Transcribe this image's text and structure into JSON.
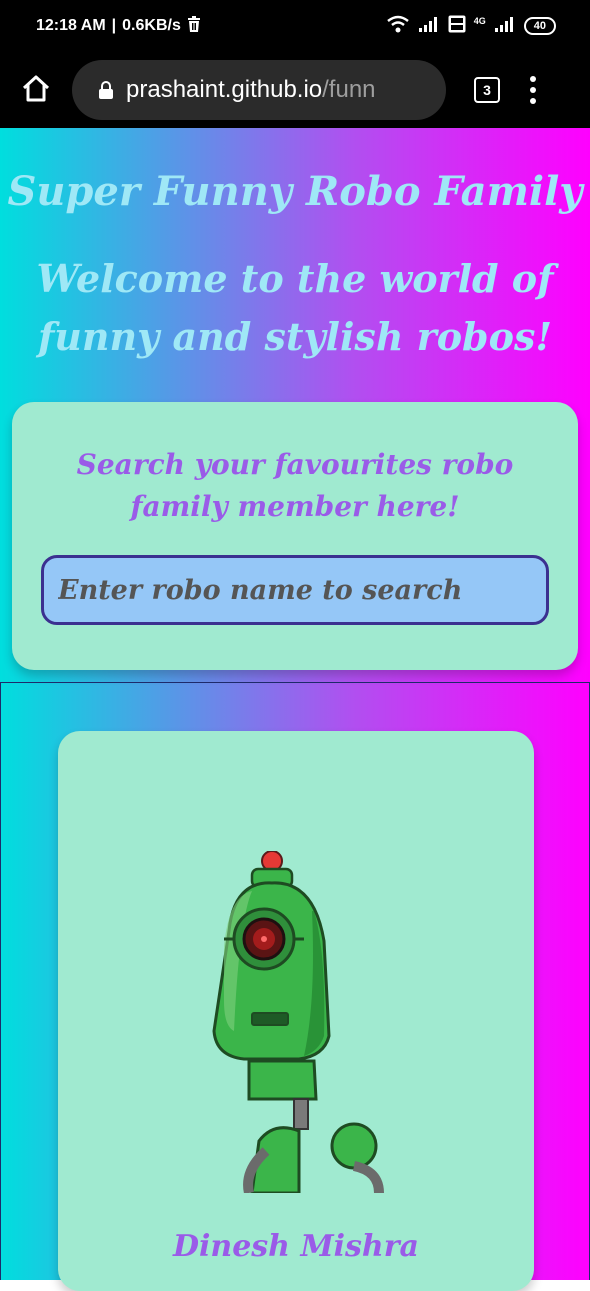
{
  "status_bar": {
    "time": "12:18 AM",
    "speed": "0.6KB/s",
    "network": "4G",
    "battery": "40"
  },
  "browser": {
    "url_host": "prashaint.github.io",
    "url_path": "/funn",
    "tab_count": "3"
  },
  "header": {
    "title": "Super Funny Robo Family",
    "welcome": "Welcome to the world of funny and stylish robos!"
  },
  "search": {
    "heading": "Search your favourites robo family member here!",
    "placeholder": "Enter robo name to search"
  },
  "robots": [
    {
      "name": "Dinesh Mishra"
    }
  ],
  "colors": {
    "gradient_start": "#00dede",
    "gradient_mid": "#b14ff0",
    "gradient_end": "#ff00ff",
    "card_bg": "#a0ead0",
    "title_text": "#9fe8f6",
    "accent_text": "#9a5be8",
    "input_bg": "#95c7f7"
  }
}
